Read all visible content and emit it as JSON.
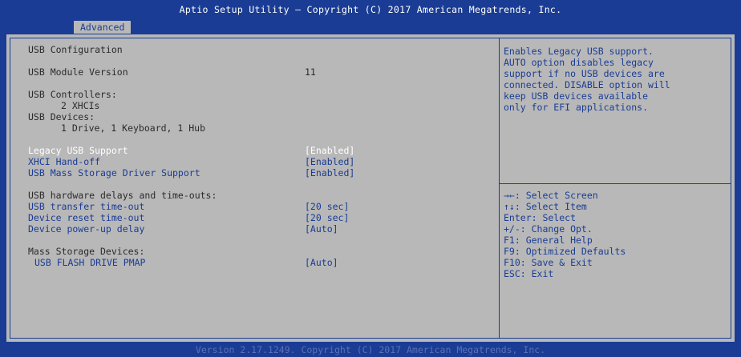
{
  "title": "Aptio Setup Utility – Copyright (C) 2017 American Megatrends, Inc.",
  "tab": "Advanced",
  "main": {
    "usb_config": "USB Configuration",
    "module_version_label": "USB Module Version",
    "module_version_value": "11",
    "controllers_label": "USB Controllers:",
    "controllers_value": "2 XHCIs",
    "devices_label": "USB Devices:",
    "devices_value": "1 Drive, 1 Keyboard, 1 Hub",
    "legacy_label": "Legacy USB Support",
    "legacy_value": "[Enabled]",
    "xhci_label": "XHCI Hand-off",
    "xhci_value": "[Enabled]",
    "mass_driver_label": "USB Mass Storage Driver Support",
    "mass_driver_value": "[Enabled]",
    "delays_heading": "USB hardware delays and time-outs:",
    "transfer_label": "USB transfer time-out",
    "transfer_value": "[20 sec]",
    "reset_label": "Device reset time-out",
    "reset_value": "[20 sec]",
    "powerup_label": "Device power-up delay",
    "powerup_value": "[Auto]",
    "mass_devices_heading": "Mass Storage Devices:",
    "flash_label": "USB FLASH DRIVE PMAP",
    "flash_value": "[Auto]"
  },
  "help": {
    "lines": [
      "Enables Legacy USB support.",
      "AUTO option disables legacy",
      "support if no USB devices are",
      "connected. DISABLE option will",
      "keep USB devices available",
      "only for EFI applications."
    ]
  },
  "keys": {
    "lines": [
      "→←: Select Screen",
      "↑↓: Select Item",
      "Enter: Select",
      "+/-: Change Opt.",
      "F1: General Help",
      "F9: Optimized Defaults",
      "F10: Save & Exit",
      "ESC: Exit"
    ]
  },
  "footer": "Version 2.17.1249. Copyright (C) 2017 American Megatrends, Inc."
}
